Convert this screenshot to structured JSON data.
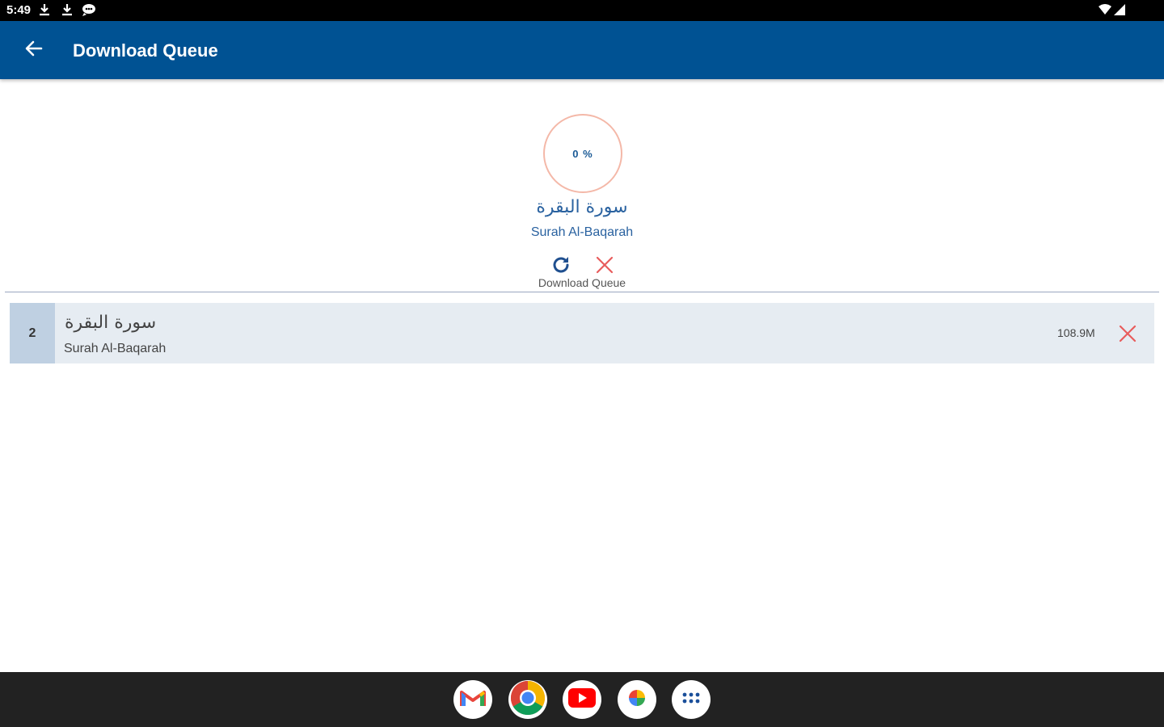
{
  "status_bar": {
    "time": "5:49",
    "icons": [
      "download-icon",
      "download-icon",
      "chat-icon",
      "wifi-icon",
      "signal-icon"
    ]
  },
  "app_bar": {
    "back_icon": "arrow-left-icon",
    "title": "Download Queue",
    "color": "#005293"
  },
  "current_download": {
    "progress_text": "0 %",
    "progress_percent": 0,
    "title_arabic": "سورة البقرة",
    "title_english": "Surah Al-Baqarah",
    "retry_icon": "refresh-icon",
    "cancel_icon": "close-icon",
    "caption": "Download Queue"
  },
  "queue": [
    {
      "index": "2",
      "title_arabic": "سورة البقرة",
      "title_english": "Surah Al-Baqarah",
      "size": "108.9M",
      "remove_icon": "close-icon"
    }
  ],
  "dock": {
    "apps": [
      "gmail-icon",
      "chrome-icon",
      "youtube-icon",
      "photos-icon",
      "app-drawer-icon"
    ]
  },
  "colors": {
    "accent": "#005293",
    "text_blue": "#2a62a0",
    "cancel_red": "#e85c5c",
    "row_bg": "#e6ecf2",
    "index_bg": "#bfd0e2"
  }
}
